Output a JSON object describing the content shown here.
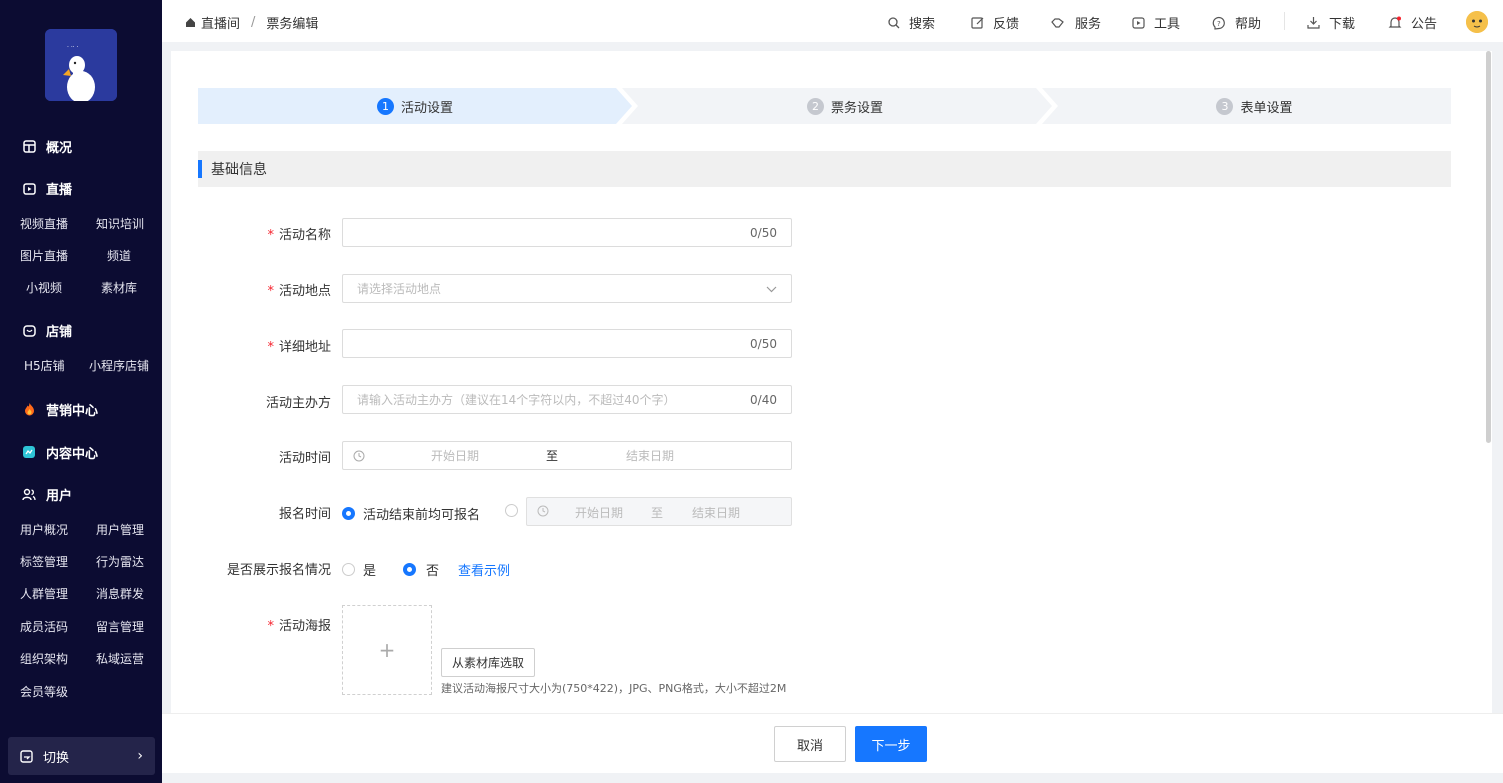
{
  "sidebar": {
    "sections": [
      {
        "label": "概况",
        "icon": "dashboard-icon"
      },
      {
        "label": "直播",
        "icon": "live-tv-icon"
      },
      {
        "label": "店铺",
        "icon": "store-icon"
      },
      {
        "label": "营销中心",
        "icon": "fire-icon"
      },
      {
        "label": "内容中心",
        "icon": "content-icon"
      },
      {
        "label": "用户",
        "icon": "users-icon"
      }
    ],
    "live_items": [
      "视频直播",
      "知识培训",
      "图片直播",
      "频道",
      "小视频",
      "素材库"
    ],
    "store_items": [
      "H5店铺",
      "小程序店铺"
    ],
    "user_items": [
      "用户概况",
      "用户管理",
      "标签管理",
      "行为雷达",
      "人群管理",
      "消息群发",
      "成员活码",
      "留言管理",
      "组织架构",
      "私域运营",
      "会员等级"
    ],
    "switch_label": "切换",
    "switch_chevron": "›"
  },
  "topbar": {
    "breadcrumb_home": "直播间",
    "breadcrumb_sep": "/",
    "breadcrumb_current": "票务编辑",
    "tools": {
      "search": "搜索",
      "feedback": "反馈",
      "service": "服务",
      "tools": "工具",
      "help": "帮助",
      "download": "下载",
      "notice": "公告"
    }
  },
  "steps": [
    {
      "num": "1",
      "label": "活动设置"
    },
    {
      "num": "2",
      "label": "票务设置"
    },
    {
      "num": "3",
      "label": "表单设置"
    }
  ],
  "section_title": "基础信息",
  "form": {
    "required_mark": "*",
    "name_label": "活动名称",
    "name_count": "0/50",
    "location_label": "活动地点",
    "location_placeholder": "请选择活动地点",
    "address_label": "详细地址",
    "address_count": "0/50",
    "organizer_label": "活动主办方",
    "organizer_placeholder": "请输入活动主办方（建议在14个字符以内，不超过40个字）",
    "organizer_count": "0/40",
    "time_label": "活动时间",
    "start_date": "开始日期",
    "to": "至",
    "end_date": "结束日期",
    "signup_label": "报名时间",
    "signup_opt1": "活动结束前均可报名",
    "show_label": "是否展示报名情况",
    "yes": "是",
    "no": "否",
    "view_example": "查看示例",
    "poster_label": "活动海报",
    "poster_plus": "+",
    "library_button": "从素材库选取",
    "poster_hint": "建议活动海报尺寸大小为(750*422)，JPG、PNG格式，大小不超过2M"
  },
  "footer": {
    "cancel": "取消",
    "next": "下一步"
  },
  "colors": {
    "primary": "#1677ff",
    "sidebar_bg": "#0c0c32",
    "required": "#f5222d"
  }
}
